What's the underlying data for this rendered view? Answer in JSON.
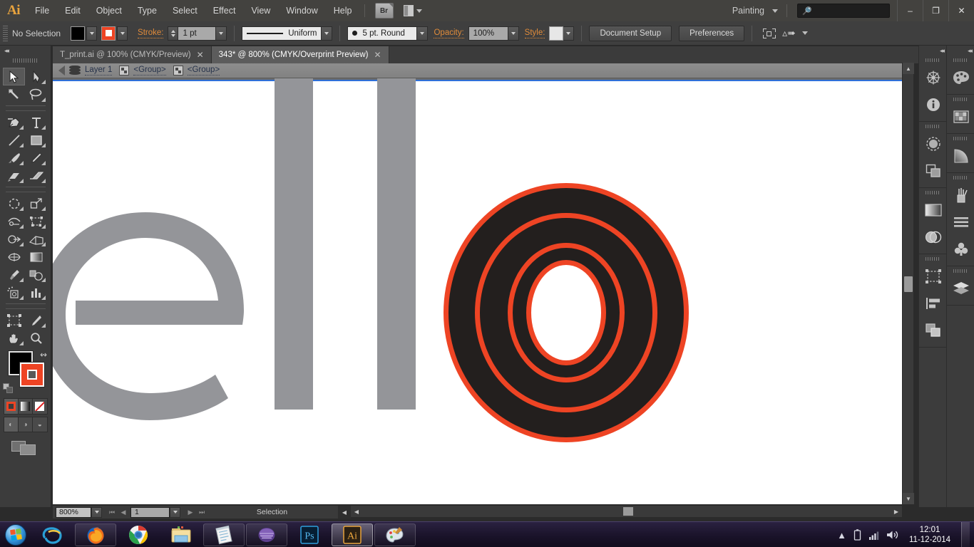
{
  "app": {
    "name": "Ai",
    "logo_color": "#e8a33d"
  },
  "menubar": {
    "items": [
      "File",
      "Edit",
      "Object",
      "Type",
      "Select",
      "Effect",
      "View",
      "Window",
      "Help"
    ],
    "bridge_label": "Br",
    "workspace": "Painting",
    "search_placeholder": "",
    "window_controls": {
      "minimize": "–",
      "restore": "❐",
      "close": "✕"
    }
  },
  "controlbar": {
    "selection_status": "No Selection",
    "fill_color": "#000000",
    "stroke_color": "#ee4424",
    "stroke_label": "Stroke:",
    "stroke_weight": "1 pt",
    "stroke_profile": "Uniform",
    "brush": "5 pt. Round",
    "opacity_label": "Opacity:",
    "opacity_value": "100%",
    "style_label": "Style:",
    "style_color": "#e7e7e7",
    "document_setup": "Document Setup",
    "preferences": "Preferences"
  },
  "tabs": [
    {
      "label": "T_print.ai @ 100% (CMYK/Preview)",
      "active": false,
      "close": "✕"
    },
    {
      "label": "343* @ 800% (CMYK/Overprint Preview)",
      "active": true,
      "close": "✕"
    }
  ],
  "breadcrumb": {
    "layer": "Layer 1",
    "group_1": "<Group>",
    "group_2": "<Group>"
  },
  "toolbar": {
    "tools": [
      "selection-tool",
      "direct-selection-tool",
      "magic-wand-tool",
      "lasso-tool",
      "pen-tool",
      "type-tool",
      "line-segment-tool",
      "rectangle-tool",
      "paintbrush-tool",
      "pencil-tool",
      "blob-brush-tool",
      "eraser-tool",
      "rotate-tool",
      "scale-tool",
      "width-tool",
      "free-transform-tool",
      "shape-builder-tool",
      "perspective-grid-tool",
      "mesh-tool",
      "gradient-tool",
      "eyedropper-tool",
      "blend-tool",
      "symbol-sprayer-tool",
      "column-graph-tool",
      "artboard-tool",
      "slice-tool",
      "hand-tool",
      "zoom-tool"
    ],
    "active_tool": "selection-tool",
    "fill_color": "#000000",
    "stroke_color": "#ee4424",
    "color_modes": [
      "color-mode",
      "gradient-mode",
      "none-mode"
    ],
    "active_color_mode": "color-mode"
  },
  "canvas": {
    "background": "#ffffff",
    "artwork_text": "ello",
    "letter_color": "#949599",
    "ring_outer_color": "#ee4424",
    "ring_fill_color": "#231f1e"
  },
  "statusbar": {
    "zoom": "800%",
    "page": "1",
    "status": "Selection"
  },
  "dock": {
    "column_1": [
      "brushes-icon",
      "info-icon",
      "transparency-icon",
      "pathfinder-icon",
      "gradient-icon",
      "appearance-icon",
      "artboards-icon",
      "align-icon",
      "layers-panel-icon"
    ],
    "column_2": [
      "color-icon",
      "swatches-icon",
      "color-guide-icon",
      "brush-library-icon",
      "stroke-icon",
      "symbols-icon",
      "layers-icon"
    ]
  },
  "taskbar": {
    "start": "start-orb",
    "apps": [
      "internet-explorer-icon",
      "firefox-icon",
      "chrome-icon",
      "file-explorer-icon",
      "notepad-icon",
      "media-app-icon",
      "photoshop-icon",
      "illustrator-icon",
      "paint-icon"
    ],
    "active_app": "illustrator-icon",
    "tray_icons": [
      "show-hidden-icon",
      "battery-icon",
      "network-icon",
      "volume-icon"
    ],
    "time": "12:01",
    "date": "11-12-2014"
  }
}
